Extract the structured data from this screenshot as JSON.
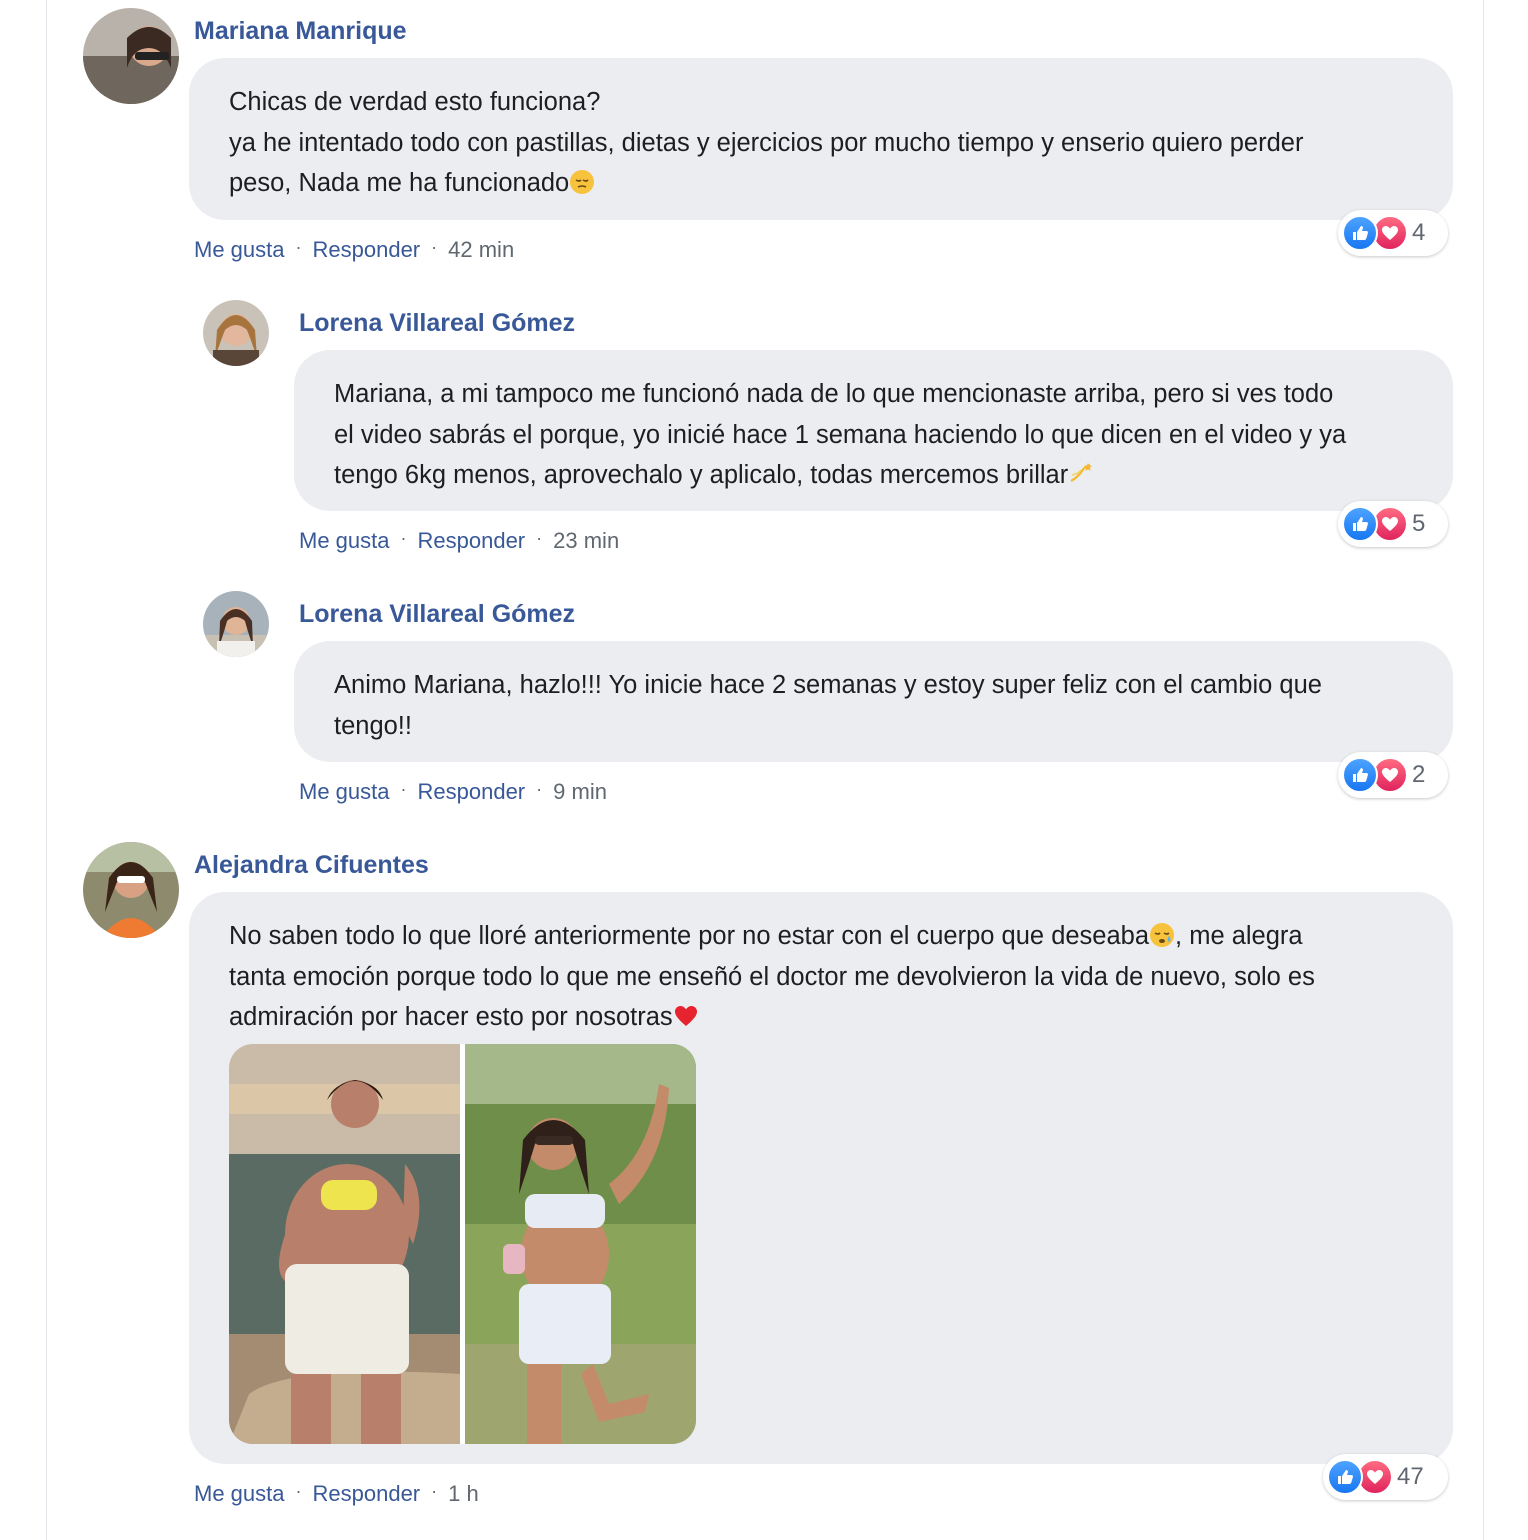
{
  "comments": [
    {
      "author": "Mariana Manrique",
      "lines": [
        "Chicas de verdad esto funciona?",
        "ya he intentado todo con pastillas, dietas y ejercicios por mucho tiempo y enserio quiero perder",
        "peso, Nada me ha funcionado"
      ],
      "emoji": "pensive-face",
      "like": "Me gusta",
      "reply": "Responder",
      "time": "42 min",
      "reaction_count": "4"
    },
    {
      "author": "Lorena Villareal Gómez",
      "lines": [
        "Mariana, a mi tampoco me funcionó nada de lo que mencionaste arriba, pero si ves todo",
        "el video sabrás el porque, yo inicié hace 1 semana haciendo lo que dicen en el video y ya",
        "tengo 6kg menos, aprovechalo y aplicalo, todas mercemos brillar"
      ],
      "emoji": "dizzy-sparkle",
      "like": "Me gusta",
      "reply": "Responder",
      "time": "23 min",
      "reaction_count": "5"
    },
    {
      "author": "Lorena Villareal Gómez",
      "lines": [
        "Animo Mariana, hazlo!!! Yo inicie hace 2 semanas y estoy super feliz con el cambio que",
        "tengo!!"
      ],
      "like": "Me gusta",
      "reply": "Responder",
      "time": "9 min",
      "reaction_count": "2"
    },
    {
      "author": "Alejandra Cifuentes",
      "lines": [
        "No saben todo lo que lloré anteriormente por no estar con el cuerpo que deseaba",
        ", me alegra",
        "tanta emoción porque todo lo que me enseñó el doctor me devolvieron la vida de nuevo, solo es",
        "admiración por hacer esto por nosotras"
      ],
      "emoji": "sleepy-face",
      "emoji2": "red-heart",
      "like": "Me gusta",
      "reply": "Responder",
      "time": "1 h",
      "reaction_count": "47",
      "photo": "before-after-photo"
    }
  ],
  "icons": {
    "like": "thumbs-up-icon",
    "love": "heart-icon"
  },
  "colors": {
    "name": "#385898",
    "bubble": "#ebedf0",
    "like_blue": "#1877f2",
    "love_red": "#e0245e"
  }
}
